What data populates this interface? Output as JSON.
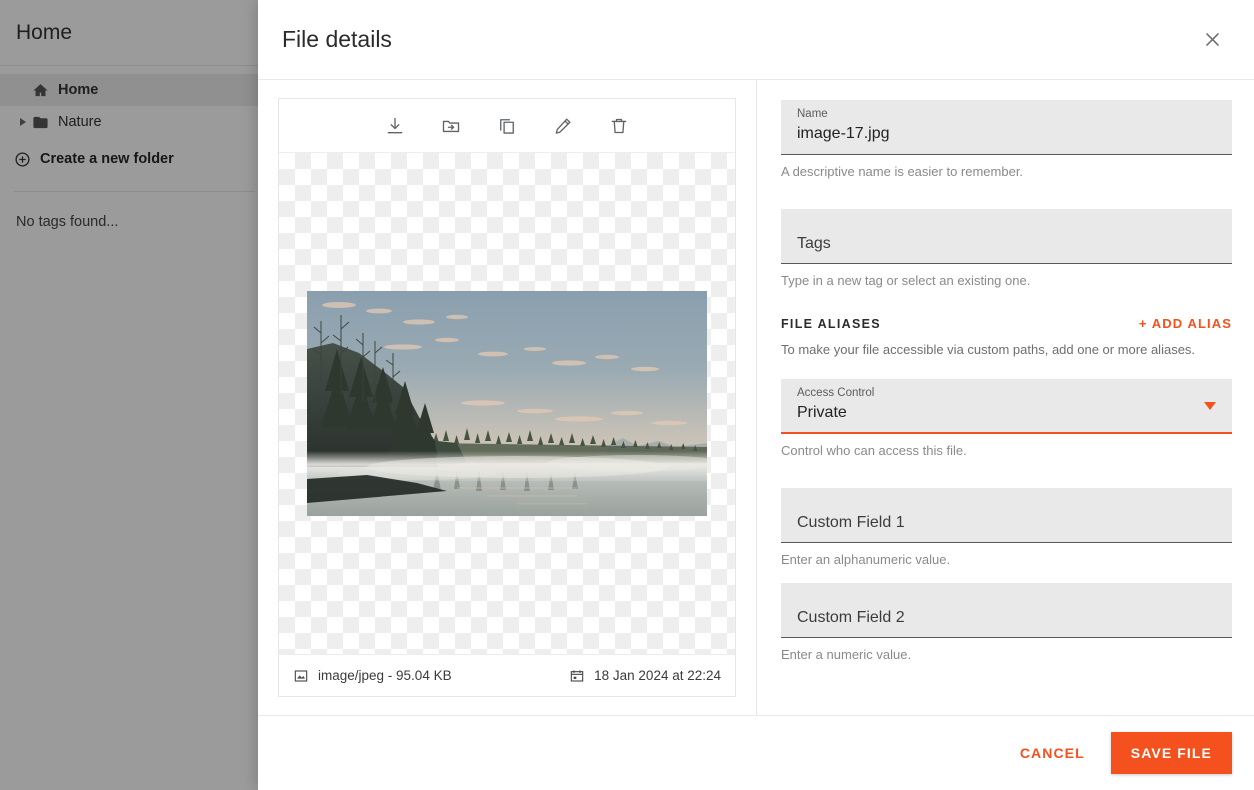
{
  "sidebar": {
    "header_title": "Home",
    "tree": [
      {
        "label": "Home",
        "icon": "home-icon",
        "selected": true
      },
      {
        "label": "Nature",
        "icon": "folder-icon",
        "selected": false
      }
    ],
    "create_folder_label": "Create a new folder",
    "tags_empty_text": "No tags found..."
  },
  "modal": {
    "title": "File details",
    "close_icon": "close-icon"
  },
  "preview": {
    "toolbar": [
      {
        "name": "download-icon",
        "label": "Download"
      },
      {
        "name": "move-to-folder-icon",
        "label": "Move to folder"
      },
      {
        "name": "copy-icon",
        "label": "Copy"
      },
      {
        "name": "edit-icon",
        "label": "Edit"
      },
      {
        "name": "delete-icon",
        "label": "Delete"
      }
    ],
    "image_alt": "Misty lake at dawn with pine forest",
    "footer": {
      "type_icon": "image-icon",
      "type_text": "image/jpeg - 95.04 KB",
      "date_icon": "calendar-icon",
      "date_text": "18 Jan 2024 at 22:24"
    }
  },
  "form": {
    "name": {
      "label": "Name",
      "value": "image-17.jpg",
      "helper": "A descriptive name is easier to remember."
    },
    "tags": {
      "placeholder": "Tags",
      "value": "",
      "helper": "Type in a new tag or select an existing one."
    },
    "aliases": {
      "section_title": "FILE ALIASES",
      "add_button": "+ ADD ALIAS",
      "description": "To make your file accessible via custom paths, add one or more aliases."
    },
    "access_control": {
      "label": "Access Control",
      "value": "Private",
      "helper": "Control who can access this file.",
      "focused": true
    },
    "custom_field_1": {
      "placeholder": "Custom Field 1",
      "value": "",
      "helper": "Enter an alphanumeric value."
    },
    "custom_field_2": {
      "placeholder": "Custom Field 2",
      "value": "",
      "helper": "Enter a numeric value."
    }
  },
  "footer": {
    "cancel_label": "CANCEL",
    "save_label": "SAVE FILE"
  },
  "colors": {
    "accent": "#f4511e",
    "field_bg": "#e9e9e9",
    "backdrop": "rgba(0,0,0,0.38)"
  }
}
